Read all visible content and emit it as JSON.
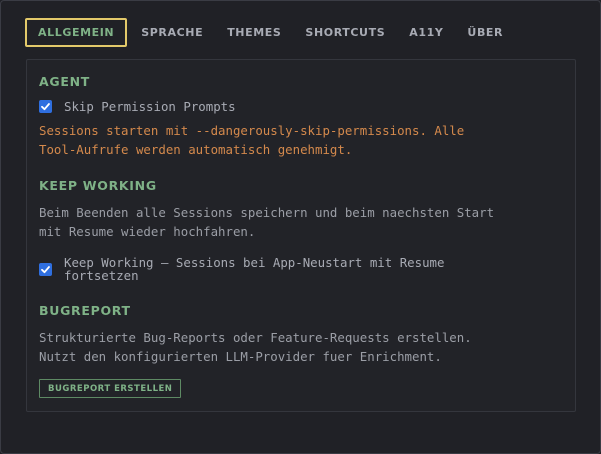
{
  "tabs": [
    {
      "label": "ALLGEMEIN",
      "active": true
    },
    {
      "label": "SPRACHE",
      "active": false
    },
    {
      "label": "THEMES",
      "active": false
    },
    {
      "label": "SHORTCUTS",
      "active": false
    },
    {
      "label": "A11Y",
      "active": false
    },
    {
      "label": "ÜBER",
      "active": false
    }
  ],
  "agent": {
    "title": "AGENT",
    "skip_permissions_label": "Skip Permission Prompts",
    "skip_permissions_checked": true,
    "warning_line1": "Sessions starten mit --dangerously-skip-permissions. Alle",
    "warning_line2": "Tool-Aufrufe werden automatisch genehmigt."
  },
  "keep_working": {
    "title": "KEEP WORKING",
    "desc_line1": "Beim Beenden alle Sessions speichern und beim naechsten Start",
    "desc_line2": "mit Resume wieder hochfahren.",
    "checkbox_label_line1": "Keep Working — Sessions bei App-Neustart mit Resume",
    "checkbox_label_line2": "fortsetzen",
    "checkbox_checked": true
  },
  "bugreport": {
    "title": "BUGREPORT",
    "desc_line1": "Strukturierte Bug-Reports oder Feature-Requests erstellen.",
    "desc_line2": "Nutzt den konfigurierten LLM-Provider fuer Enrichment.",
    "button_label": "BUGREPORT ERSTELLEN"
  },
  "colors": {
    "accent_green": "#7fb287",
    "active_tab_border": "#e2c96a",
    "warning": "#d4894c",
    "checkbox": "#2f6fe0",
    "background": "#202126"
  }
}
